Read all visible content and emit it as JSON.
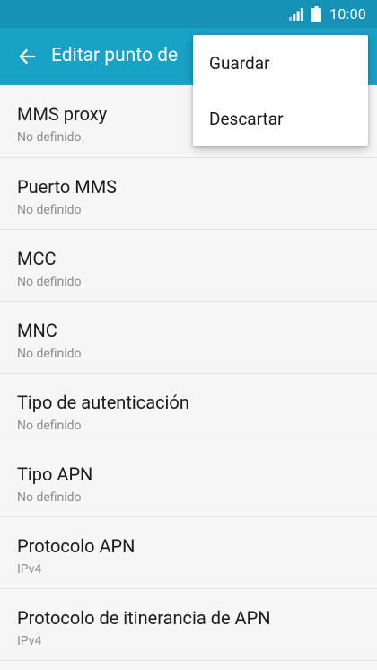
{
  "status_bar": {
    "time": "10:00",
    "icons": [
      "signal-icon",
      "battery-icon"
    ]
  },
  "colors": {
    "status_bar": "#1592b6",
    "app_bar": "#18a2c6",
    "background": "#f6f6f6",
    "divider": "#e2e2e2",
    "primary_text": "#1b1b1b",
    "secondary_text": "#8c8c8c"
  },
  "app_bar": {
    "title": "Editar punto de",
    "back_icon": "arrow-left-icon"
  },
  "settings": [
    {
      "label": "MMS proxy",
      "value": "No definido"
    },
    {
      "label": "Puerto MMS",
      "value": "No definido"
    },
    {
      "label": "MCC",
      "value": "No definido"
    },
    {
      "label": "MNC",
      "value": "No definido"
    },
    {
      "label": "Tipo de autenticación",
      "value": "No definido"
    },
    {
      "label": "Tipo APN",
      "value": "No definido"
    },
    {
      "label": "Protocolo APN",
      "value": "IPv4"
    },
    {
      "label": "Protocolo de itinerancia de APN",
      "value": "IPv4"
    }
  ],
  "menu": {
    "items": [
      {
        "label": "Guardar"
      },
      {
        "label": "Descartar"
      }
    ]
  }
}
